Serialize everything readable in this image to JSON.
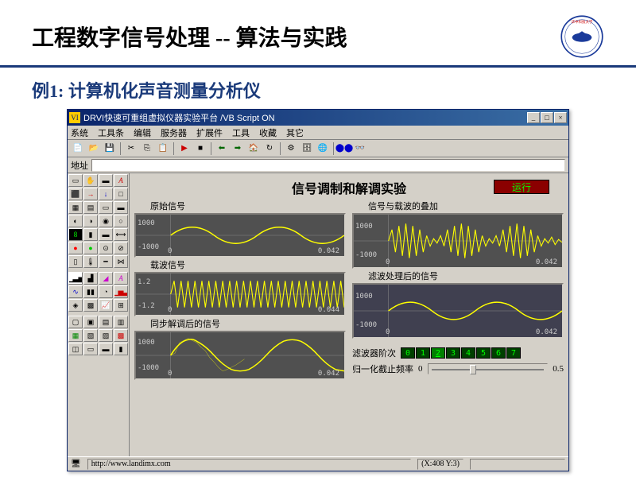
{
  "slide": {
    "title": "工程数字信号处理 -- 算法与实践",
    "example_label": "例1: 计算机化声音测量分析仪",
    "logo_text": "华中科技大学"
  },
  "app": {
    "title": "DRVI快速可重组虚拟仪器实验平台 /VB Script ON",
    "menus": [
      "系统",
      "工具条",
      "编辑",
      "服务器",
      "扩展件",
      "工具",
      "收藏",
      "其它"
    ],
    "address_label": "地址",
    "canvas_title": "信号调制和解调实验",
    "run_label": "运行",
    "status_url": "http://www.landimx.com",
    "status_coords": "(X:408 Y:3)"
  },
  "plots": {
    "p1_label": "原始信号",
    "p2_label": "载波信号",
    "p3_label": "同步解调后的信号",
    "p4_label": "信号与载波的叠加",
    "p5_label": "滤波处理后的信号",
    "y1000p": "1000",
    "y1000n": "-1000",
    "y12p": "1.2",
    "y12n": "-1.2",
    "x0": "0",
    "x042": "0.042",
    "x044": "0.044"
  },
  "controls": {
    "order_label": "滤波器阶次",
    "order_values": [
      "0",
      "1",
      "2",
      "3",
      "4",
      "5",
      "6",
      "7"
    ],
    "order_selected": 2,
    "cutoff_label": "归一化截止频率",
    "cutoff_min": "0",
    "cutoff_max": "0.5",
    "cutoff_pos_pct": 35
  },
  "chart_data": [
    {
      "type": "line",
      "name": "原始信号",
      "xlim": [
        0,
        0.042
      ],
      "ylim": [
        -1500,
        1500
      ],
      "desc": "low-frequency sine ~2 cycles, amplitude≈1000"
    },
    {
      "type": "line",
      "name": "载波信号",
      "xlim": [
        0,
        0.044
      ],
      "ylim": [
        -1.5,
        1.5
      ],
      "desc": "high-frequency carrier sine, amplitude≈1.2"
    },
    {
      "type": "line",
      "name": "同步解调后的信号",
      "xlim": [
        0,
        0.042
      ],
      "ylim": [
        -1500,
        1500
      ],
      "desc": "recovered sine ~2 cycles with ripple, amplitude≈1000"
    },
    {
      "type": "line",
      "name": "信号与载波的叠加",
      "xlim": [
        0,
        0.042
      ],
      "ylim": [
        -1500,
        1500
      ],
      "desc": "AM modulated waveform, envelope follows 原始信号"
    },
    {
      "type": "line",
      "name": "滤波处理后的信号",
      "xlim": [
        0,
        0.042
      ],
      "ylim": [
        -1500,
        1500
      ],
      "desc": "filtered sine ~2 cycles, amplitude≈1000"
    }
  ]
}
